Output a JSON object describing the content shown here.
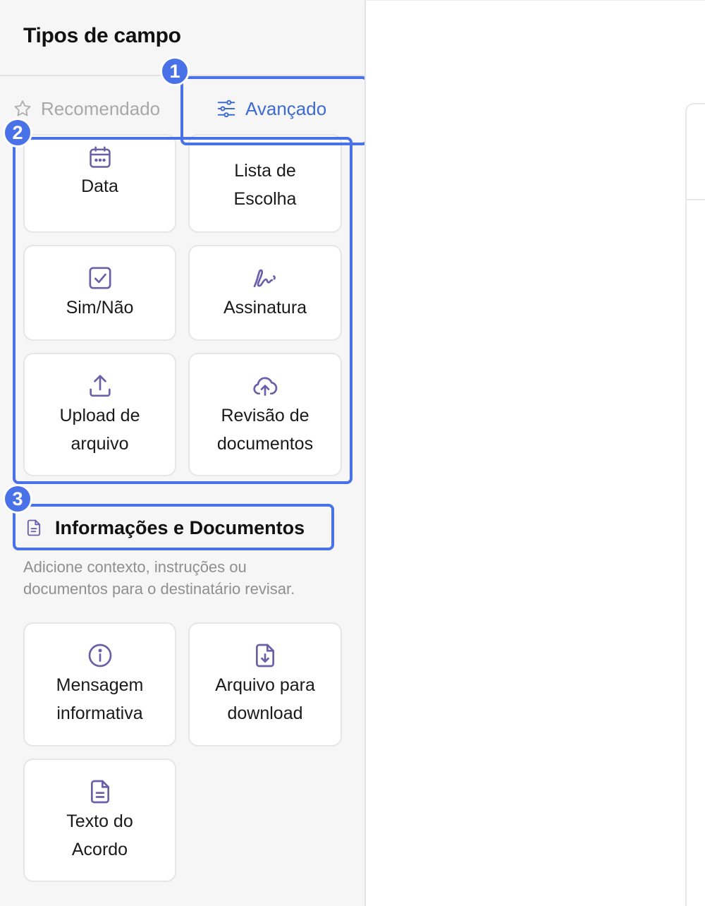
{
  "sidebar": {
    "title": "Tipos de campo",
    "tabs": [
      {
        "label": "Recomendado",
        "icon": "star-icon",
        "active": false
      },
      {
        "label": "Avançado",
        "icon": "sliders-icon",
        "active": true
      }
    ],
    "advanced_fields": [
      {
        "label": "Data",
        "icon": "calendar-icon"
      },
      {
        "label": "Lista de\nEscolha",
        "icon": "list-icon"
      },
      {
        "label": "Sim/Não",
        "icon": "checkbox-icon"
      },
      {
        "label": "Assinatura",
        "icon": "signature-icon"
      },
      {
        "label": "Upload de\narquivo",
        "icon": "upload-icon"
      },
      {
        "label": "Revisão de\ndocumentos",
        "icon": "cloud-upload-icon"
      }
    ],
    "info_section": {
      "title": "Informações e Documentos",
      "icon": "document-icon",
      "description": "Adicione contexto, instruções ou\ndocumentos para o destinatário revisar.",
      "fields": [
        {
          "label": "Mensagem\ninformativa",
          "icon": "info-icon"
        },
        {
          "label": "Arquivo para\ndownload",
          "icon": "file-download-icon"
        },
        {
          "label": "Texto do\nAcordo",
          "icon": "file-text-icon"
        }
      ]
    }
  },
  "annotations": [
    "1",
    "2",
    "3"
  ],
  "colors": {
    "accent": "#4a72e8",
    "icon": "#6b5fa8",
    "tab_active": "#3d6bd1",
    "muted": "#a8a8a8"
  }
}
